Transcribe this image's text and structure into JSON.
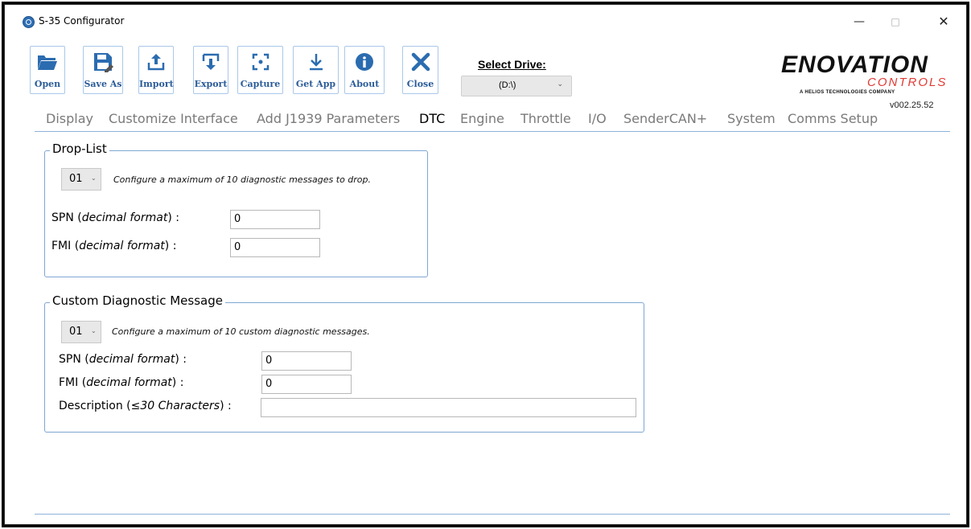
{
  "window": {
    "title": "S-35 Configurator",
    "minimize": "—",
    "maximize": "□",
    "close": "✕"
  },
  "toolbar": {
    "buttons": [
      {
        "label": "Open",
        "icon": "folder-icon"
      },
      {
        "label": "Save As",
        "icon": "save-icon"
      },
      {
        "label": "Import",
        "icon": "import-icon"
      },
      {
        "label": "Export",
        "icon": "export-icon"
      },
      {
        "label": "Capture",
        "icon": "capture-icon"
      },
      {
        "label": "Get App",
        "icon": "download-icon"
      },
      {
        "label": "About",
        "icon": "info-icon"
      },
      {
        "label": "Close",
        "icon": "close-icon"
      }
    ],
    "select_drive_label": "Select Drive:",
    "drive_value": "(D:\\)"
  },
  "brand": {
    "logo_main": "ENOVATION",
    "logo_sub": "CONTROLS",
    "logo_tagline": "A HELIOS TECHNOLOGIES COMPANY",
    "version": "v002.25.52",
    "accent_color": "#e03a34"
  },
  "tabs": [
    {
      "label": "Display",
      "active": false
    },
    {
      "label": "Customize Interface",
      "active": false
    },
    {
      "label": "Add J1939 Parameters",
      "active": false
    },
    {
      "label": "DTC",
      "active": true
    },
    {
      "label": "Engine",
      "active": false
    },
    {
      "label": "Throttle",
      "active": false
    },
    {
      "label": "I/O",
      "active": false
    },
    {
      "label": "SenderCAN+",
      "active": false
    },
    {
      "label": "System",
      "active": false
    },
    {
      "label": "Comms Setup",
      "active": false
    }
  ],
  "drop_list": {
    "title": "Drop-List",
    "index": "01",
    "note": "Configure a maximum of 10 diagnostic messages to drop.",
    "spn_label": "SPN (",
    "spn_label_em": "decimal format",
    "spn_label_end": ") :",
    "spn_value": "0",
    "fmi_label": "FMI (",
    "fmi_label_em": "decimal format",
    "fmi_label_end": ") :",
    "fmi_value": "0"
  },
  "custom_message": {
    "title": "Custom Diagnostic Message",
    "index": "01",
    "note": "Configure a maximum of 10 custom diagnostic messages.",
    "spn_label": "SPN (",
    "spn_label_em": "decimal format",
    "spn_label_end": ") :",
    "spn_value": "0",
    "fmi_label": "FMI (",
    "fmi_label_em": "decimal format",
    "fmi_label_end": ") :",
    "fmi_value": "0",
    "desc_label": "Description (",
    "desc_label_em": "≤30 Characters",
    "desc_label_end": ") :",
    "desc_value": ""
  }
}
